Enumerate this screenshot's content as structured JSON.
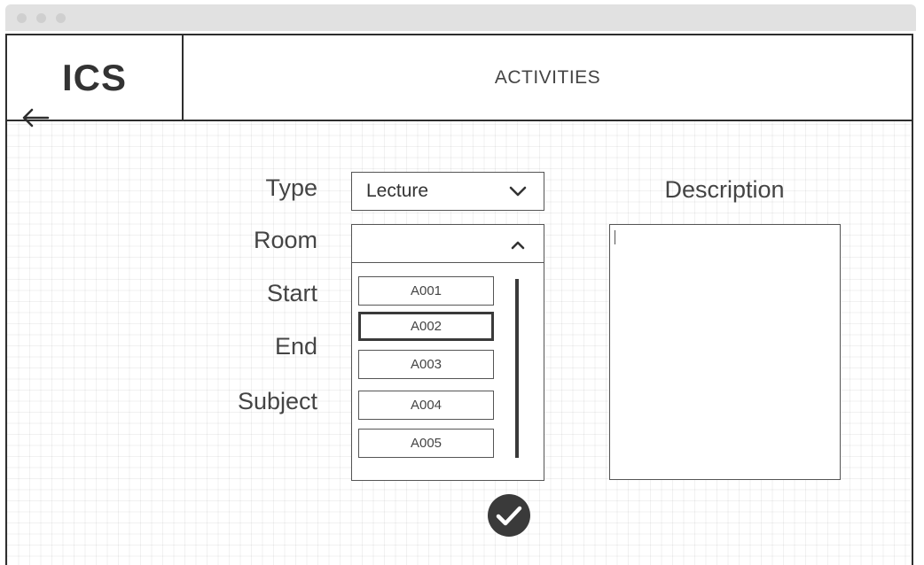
{
  "app": {
    "logo": "ICS",
    "title": "ACTIVITIES"
  },
  "icons": {
    "back": "arrow-left-icon",
    "chevron_down": "chevron-down-icon",
    "chevron_up": "chevron-up-icon",
    "confirm": "check-circle-icon"
  },
  "form": {
    "labels": {
      "type": "Type",
      "room": "Room",
      "start": "Start",
      "end": "End",
      "subject": "Subject"
    },
    "type_value": "Lecture",
    "room_value": "",
    "room_options": [
      "A001",
      "A002",
      "A003",
      "A004",
      "A005"
    ],
    "room_highlighted": "A002"
  },
  "description": {
    "label": "Description",
    "value": ""
  },
  "colors": {
    "stroke": "#2e2e2e",
    "text": "#444444",
    "confirm": "#3a3a3a"
  }
}
